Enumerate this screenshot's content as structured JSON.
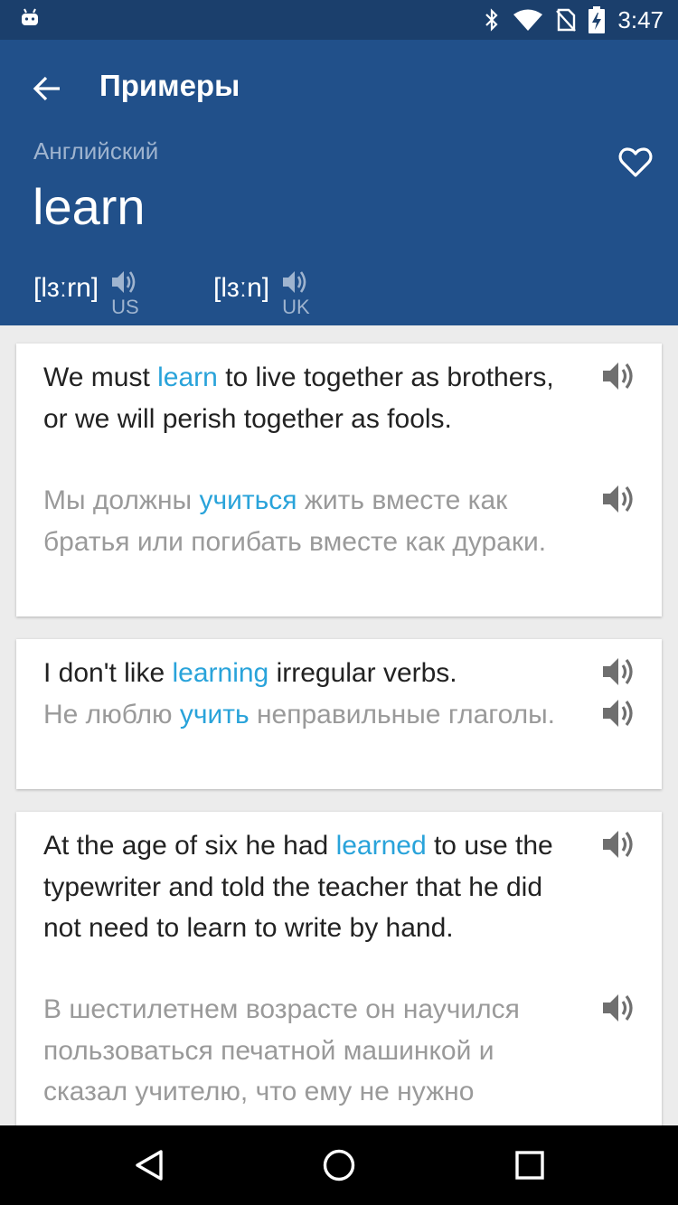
{
  "status_bar": {
    "time": "3:47",
    "icons": [
      "android-icon",
      "bluetooth-icon",
      "wifi-icon",
      "no-sim-icon",
      "battery-charging-icon"
    ]
  },
  "toolbar": {
    "title": "Примеры",
    "back_icon": "arrow-back-icon"
  },
  "header": {
    "language": "Английский",
    "word": "learn",
    "favorite_icon": "heart-outline-icon",
    "pronunciations": [
      {
        "ipa": "[lɜːrn]",
        "region": "US"
      },
      {
        "ipa": "[lɜːn]",
        "region": "UK"
      }
    ]
  },
  "examples": [
    {
      "en": {
        "before": "We must ",
        "highlight": "learn",
        "after": " to live together as brothers, or we will perish together as fools."
      },
      "ru": {
        "before": "Мы должны ",
        "highlight": "учиться",
        "after": " жить вместе как братья или погибать вместе как дураки."
      }
    },
    {
      "en": {
        "before": "I don't like ",
        "highlight": "learning",
        "after": " irregular verbs."
      },
      "ru": {
        "before": "Не люблю ",
        "highlight": "учить",
        "after": " неправильные глаголы."
      }
    },
    {
      "en": {
        "before": "At the age of six he had ",
        "highlight": "learned",
        "after": " to use the typewriter and told the teacher that he did not need to learn to write by hand."
      },
      "ru": {
        "before": "",
        "highlight": "",
        "after": "В шестилетнем возрасте он научился пользоваться печатной машинкой и сказал учителю, что ему не нужно"
      }
    }
  ],
  "colors": {
    "status_bar": "#1b3f6c",
    "header": "#21508a",
    "highlight": "#29a3da",
    "translation_text": "#9a9a9a",
    "background": "#ececec"
  },
  "nav_bar": {
    "icons": [
      "back-triangle-icon",
      "home-circle-icon",
      "recents-square-icon"
    ]
  }
}
